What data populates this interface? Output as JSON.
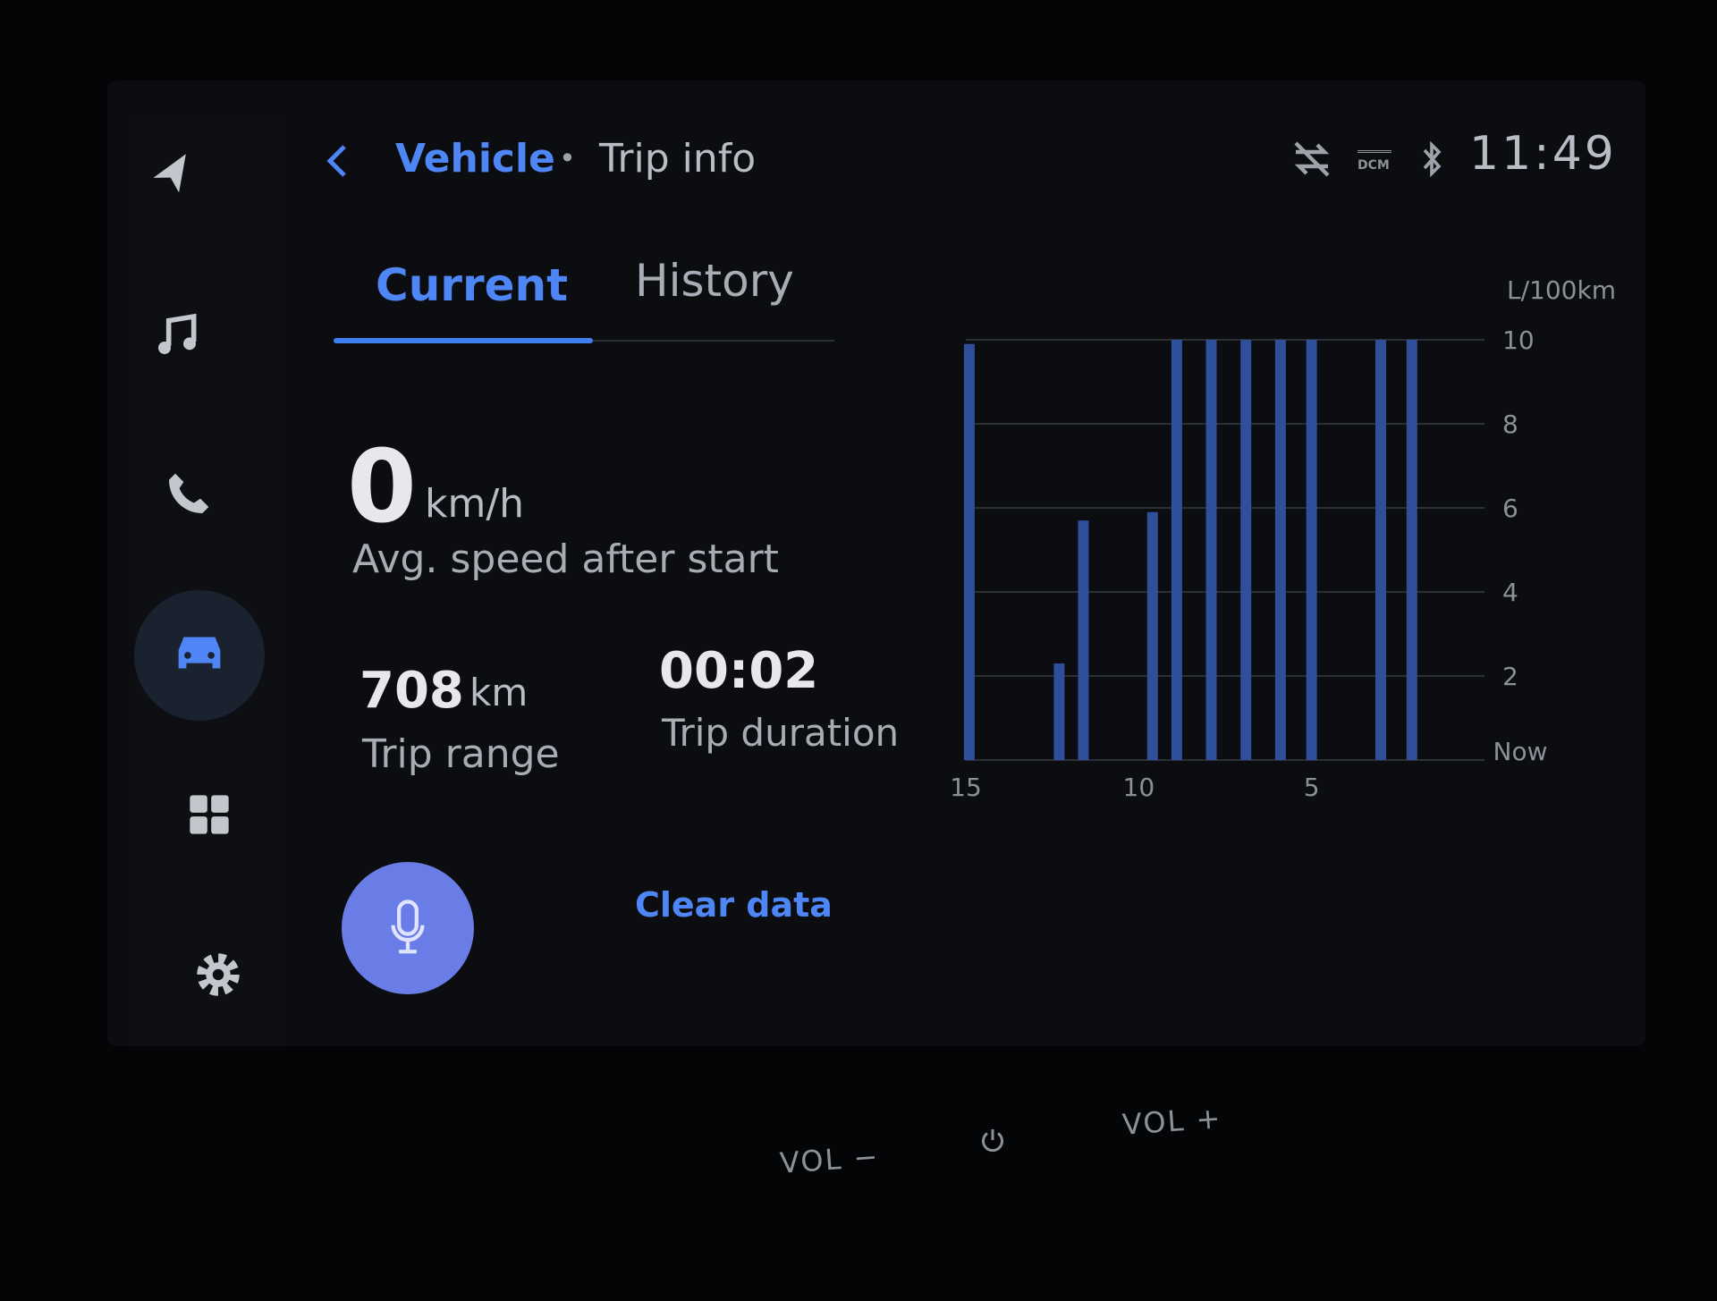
{
  "sidebar": {
    "items": [
      {
        "icon": "navigation-arrow-icon"
      },
      {
        "icon": "music-note-icon"
      },
      {
        "icon": "phone-icon"
      },
      {
        "icon": "car-icon",
        "active": true
      },
      {
        "icon": "apps-grid-icon"
      },
      {
        "icon": "gear-icon"
      }
    ]
  },
  "header": {
    "back_icon": "chevron-left-icon",
    "breadcrumb_parent": "Vehicle",
    "separator": "•",
    "breadcrumb_current": "Trip info"
  },
  "status": {
    "icons": [
      "data-off-icon",
      "dcm-icon",
      "bluetooth-icon"
    ],
    "dcm_label": "DCM",
    "time": "11:49"
  },
  "tabs": [
    {
      "label": "Current",
      "active": true
    },
    {
      "label": "History",
      "active": false
    }
  ],
  "stats": {
    "avg_speed_value": "0",
    "avg_speed_unit": "km/h",
    "avg_speed_label": "Avg. speed after start",
    "range_value": "708",
    "range_unit": "km",
    "range_label": "Trip range",
    "duration_value": "00:02",
    "duration_label": "Trip duration"
  },
  "actions": {
    "mic_icon": "microphone-icon",
    "clear_label": "Clear data"
  },
  "colors": {
    "accent": "#4e86f5",
    "bar": "#2f4f9a",
    "mic": "#6a7de6"
  },
  "chart_data": {
    "type": "bar",
    "ylabel": "L/100km",
    "ylim": [
      0,
      10
    ],
    "yticks": [
      "2",
      "4",
      "6",
      "8",
      "10"
    ],
    "xlim": [
      15,
      0
    ],
    "xticks": [
      {
        "v": 15,
        "label": "15"
      },
      {
        "v": 10,
        "label": "10"
      },
      {
        "v": 5,
        "label": "5"
      },
      {
        "v": 0,
        "label": "Now"
      }
    ],
    "grid": true,
    "x": [
      14.9,
      12.3,
      11.6,
      9.6,
      8.9,
      7.9,
      6.9,
      5.9,
      5.0,
      3.0,
      2.1
    ],
    "values": [
      9.9,
      2.3,
      5.7,
      5.9,
      10,
      10,
      10,
      10,
      10,
      10,
      10
    ]
  },
  "hardware": {
    "vol_down": "VOL −",
    "power_icon": "power-icon",
    "vol_up": "VOL +"
  }
}
